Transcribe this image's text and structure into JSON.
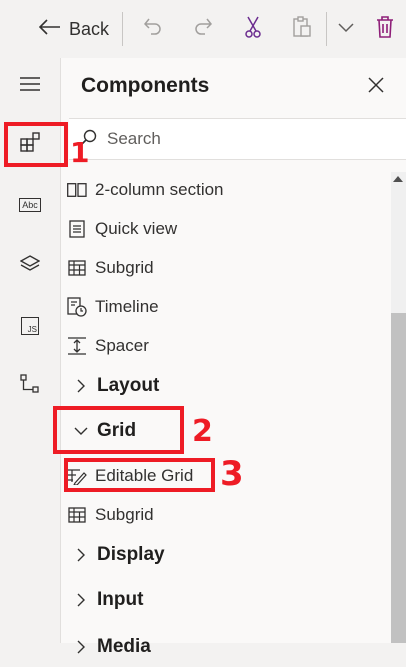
{
  "toolbar": {
    "back_label": "Back",
    "icons": [
      "back-arrow-icon",
      "undo-icon",
      "redo-icon",
      "cut-icon",
      "paste-icon",
      "chevron-down-icon",
      "delete-icon"
    ],
    "delete_color": "#8e1e78"
  },
  "rail": {
    "items": [
      "hamburger-icon",
      "components-icon",
      "text-field-icon",
      "layers-icon",
      "javascript-icon",
      "tree-view-icon"
    ],
    "text_icon_label": "Abc",
    "js_icon_label": "JS"
  },
  "panel": {
    "title": "Components",
    "search_placeholder": "Search",
    "items_before": [
      {
        "label": "2-column section",
        "icon": "two-column-icon"
      },
      {
        "label": "Quick view",
        "icon": "quick-view-icon"
      },
      {
        "label": "Subgrid",
        "icon": "subgrid-icon"
      },
      {
        "label": "Timeline",
        "icon": "timeline-icon"
      },
      {
        "label": "Spacer",
        "icon": "spacer-icon"
      }
    ],
    "groups": {
      "layout": "Layout",
      "grid": "Grid",
      "display": "Display",
      "input": "Input",
      "media": "Media"
    },
    "grid_items": [
      {
        "label": "Editable Grid",
        "icon": "editable-grid-icon"
      },
      {
        "label": "Subgrid",
        "icon": "subgrid-icon"
      }
    ]
  },
  "annotations": {
    "mark_1": "1",
    "mark_2": "2",
    "mark_3": "3",
    "color": "#ee1c25"
  }
}
